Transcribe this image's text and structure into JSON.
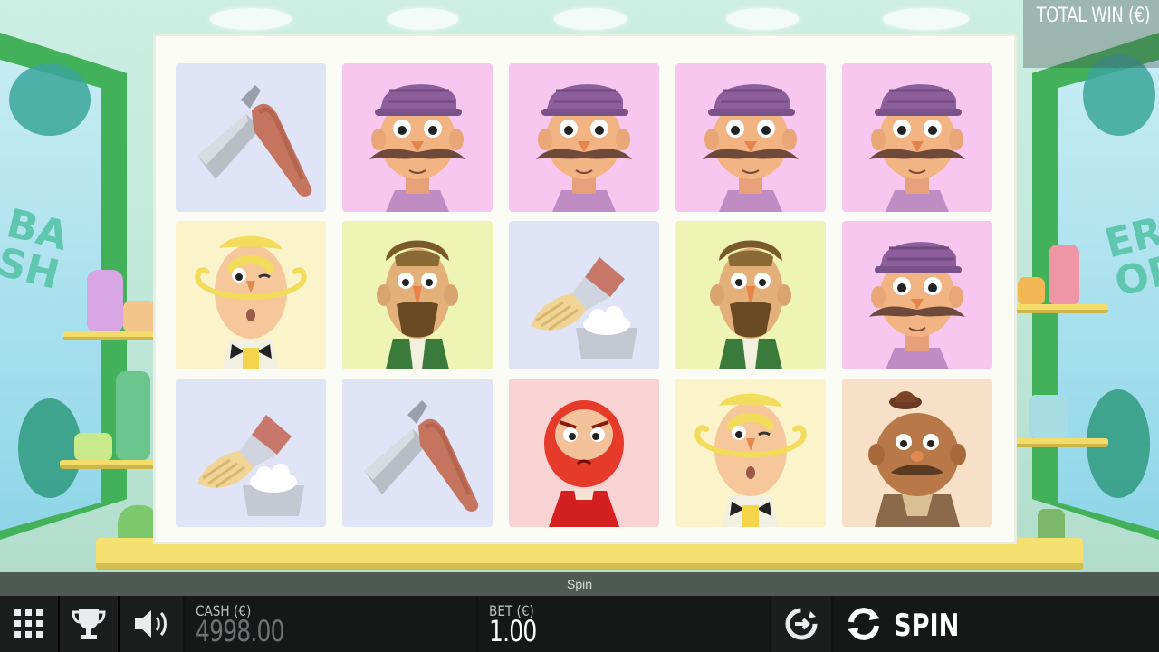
{
  "header": {
    "total_win_label": "TOTAL WIN (€)"
  },
  "reels": [
    [
      "razor",
      "blonde",
      "brush"
    ],
    [
      "cap",
      "green",
      "razor"
    ],
    [
      "cap",
      "brush",
      "red"
    ],
    [
      "cap",
      "green",
      "blonde"
    ],
    [
      "cap",
      "cap",
      "brown"
    ]
  ],
  "status": {
    "message": "Spin"
  },
  "toolbar": {
    "menu_icon": "grid-menu-icon",
    "trophy_icon": "trophy-icon",
    "sound_icon": "speaker-icon",
    "cash_label": "CASH (€)",
    "cash_value": "4998.00",
    "bet_label": "BET (€)",
    "bet_value": "1.00",
    "autoplay_icon": "autoplay-icon",
    "spin_icon": "spin-arrows-icon",
    "spin_label": "SPIN"
  },
  "colors": {
    "cap_bg": "#f7c7ef",
    "razor_bg": "#dfe4f7",
    "blonde_bg": "#fbf3c9",
    "green_bg": "#eef4b4",
    "red_bg": "#f9d2d4",
    "brown_bg": "#f8dfc7",
    "toolbar_bg": "#121414"
  }
}
